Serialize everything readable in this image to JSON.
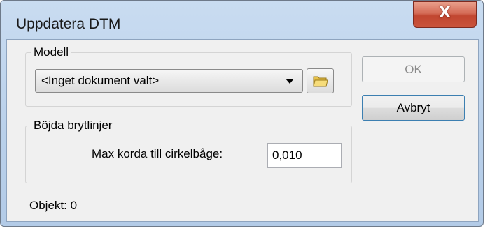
{
  "window": {
    "title": "Uppdatera DTM",
    "close_symbol": "X"
  },
  "model_group": {
    "legend": "Modell",
    "document_select": {
      "value": "<Inget dokument valt>"
    },
    "browse_icon": "folder-icon"
  },
  "curves_group": {
    "legend": "Böjda brytlinjer",
    "max_chord_label": "Max korda till cirkelbåge:",
    "max_chord_value": "0,010"
  },
  "buttons": {
    "ok": "OK",
    "ok_disabled": true,
    "cancel": "Avbryt"
  },
  "status": {
    "objects": "Objekt: 0"
  },
  "colors": {
    "close_button": "#c9543c",
    "title_bar": "#b9d0ea",
    "client_bg": "#f0f0f0"
  }
}
